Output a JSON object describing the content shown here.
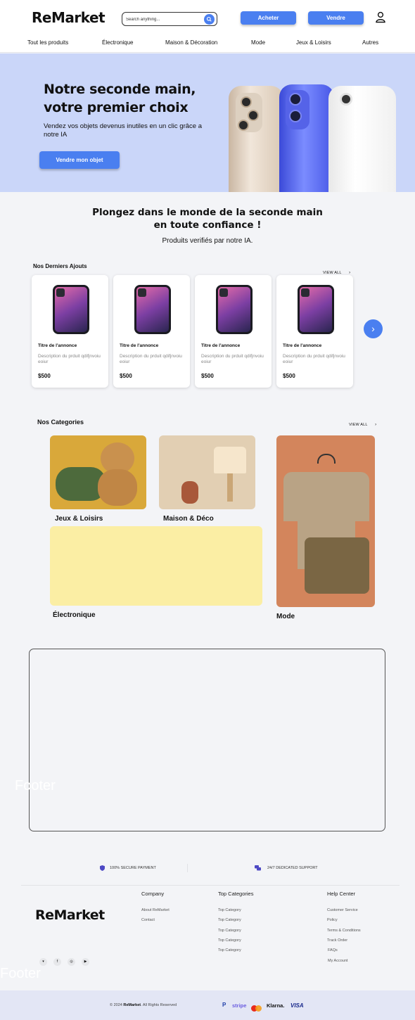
{
  "header": {
    "logo": "ReMarket",
    "search_placeholder": "Search anything...",
    "buy_label": "Acheter",
    "sell_label": "Vendre"
  },
  "nav": [
    "Tout les produits",
    "Électronique",
    "Maison & Décoration",
    "Mode",
    "Jeux & Loisirs",
    "Autres"
  ],
  "hero": {
    "title_line1": "Notre seconde main,",
    "title_line2": "votre premier choix",
    "subtitle": "Vendez vos objets devenus inutiles en un clic grâce a notre IA",
    "cta_label": "Vendre mon objet"
  },
  "intro": {
    "title_line1": "Plongez dans le monde de la seconde main",
    "title_line2": "en toute confiance !",
    "subtitle": "Produits verifiés par notre IA."
  },
  "latest": {
    "title": "Nos Derniers Ajouts",
    "view_all": "VIEW ALL",
    "cards": [
      {
        "title": "Titre de l'annonce",
        "desc": "Description du prduit qdifjnvoiu eoiur",
        "price": "$500"
      },
      {
        "title": "Titre de l'annonce",
        "desc": "Description du prduit qdifjnvoiu eoiur",
        "price": "$500"
      },
      {
        "title": "Titre de l'annonce",
        "desc": "Description du prduit qdifjnvoiu eoiur",
        "price": "$500"
      },
      {
        "title": "Titre de l'annonce",
        "desc": "Description du prduit qdifjnvoiu eoiur",
        "price": "$500"
      }
    ]
  },
  "categories": {
    "title": "Nos Categories",
    "view_all": "VIEW ALL",
    "items": [
      "Jeux & Loisirs",
      "Maison & Déco",
      "Électronique",
      "Mode"
    ]
  },
  "footer_placeholder": "Footer",
  "features": {
    "payment": "100% SECURE PAYMENT",
    "support": "24/7 DEDICATED SUPPORT"
  },
  "footer": {
    "logo": "ReMarket",
    "company": {
      "title": "Company",
      "links": [
        "About ReMarket",
        "Contact"
      ]
    },
    "top_categories": {
      "title": "Top Categories",
      "links": [
        "Top Category",
        "Top Category",
        "Top Category",
        "Top Category",
        "Top Category"
      ]
    },
    "help": {
      "title": "Help Center",
      "links": [
        "Customer Service",
        "Policy",
        "Terms & Conditions",
        "Track Order",
        "FAQs",
        "My Account"
      ]
    },
    "ghost_label": "Footer",
    "copyright_prefix": "© 2024",
    "copyright_brand": "ReMarket",
    "copyright_suffix": ". All Rights Reserved",
    "payments": [
      "P",
      "stripe",
      "Klarna.",
      "VISA"
    ]
  },
  "colors": {
    "accent": "#4a7ff0",
    "hero_bg": "#cad6f9",
    "electro_bg": "#fbeea4"
  }
}
